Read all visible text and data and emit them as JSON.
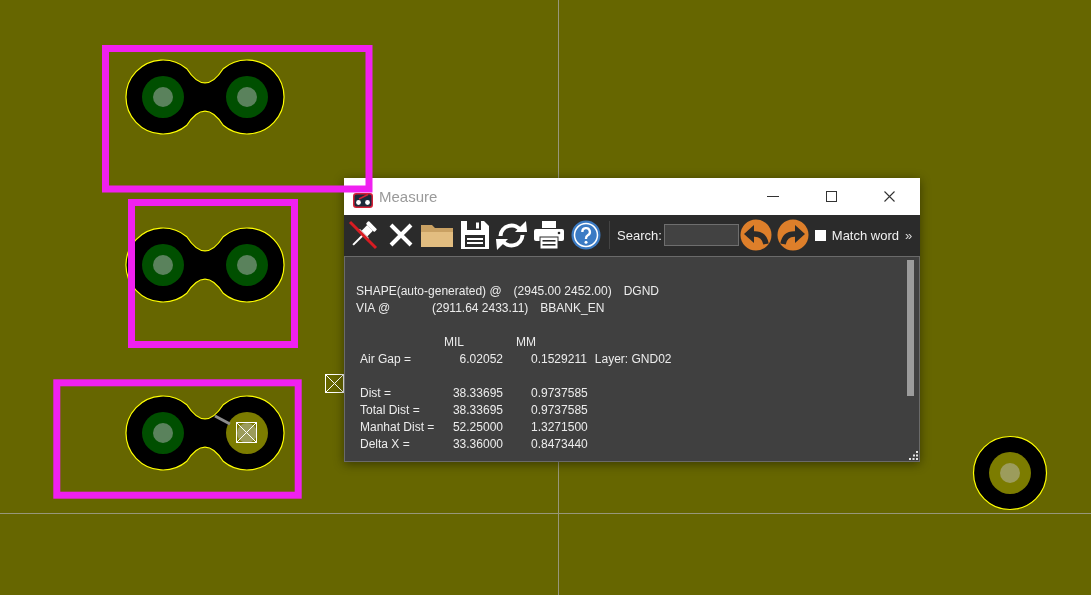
{
  "board": {
    "items": [
      {
        "kind": "pad-pair",
        "highlighted": true,
        "selected": false
      },
      {
        "kind": "pad-pair",
        "highlighted": true,
        "selected": false
      },
      {
        "kind": "pad-pair",
        "highlighted": true,
        "selected": true
      },
      {
        "kind": "via",
        "highlighted": false,
        "selected": false
      }
    ]
  },
  "window": {
    "title": "Measure"
  },
  "toolbar": {
    "search": {
      "label": "Search:"
    },
    "match_word": {
      "label": "Match word",
      "checked": false
    },
    "more": "»"
  },
  "report": {
    "objects": [
      {
        "label": "SHAPE(auto-generated) @",
        "coords": "(2945.00 2452.00)",
        "net": "DGND"
      },
      {
        "label": "VIA @",
        "coords": "(2911.64 2433.11)",
        "net": "BBANK_EN"
      }
    ],
    "units": [
      "MIL",
      "MM"
    ],
    "groups": [
      [
        {
          "label": "Air Gap =",
          "mil": "6.02052",
          "mm": "0.1529211",
          "note": "Layer: GND02"
        }
      ],
      [
        {
          "label": "Dist =",
          "mil": "38.33695",
          "mm": "0.9737585"
        },
        {
          "label": "Total Dist =",
          "mil": "38.33695",
          "mm": "0.9737585"
        },
        {
          "label": "Manhat Dist =",
          "mil": "52.25000",
          "mm": "1.3271500"
        },
        {
          "label": "Delta X =",
          "mil": "33.36000",
          "mm": "0.8473440"
        }
      ]
    ]
  }
}
